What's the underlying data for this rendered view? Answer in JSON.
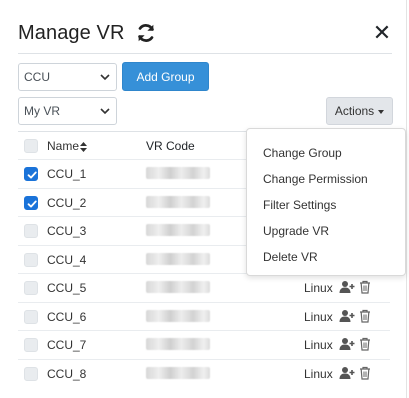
{
  "header": {
    "title": "Manage VR"
  },
  "controls": {
    "group_select": "CCU",
    "vr_select": "My VR",
    "add_group_label": "Add Group",
    "actions_label": "Actions"
  },
  "table": {
    "columns": {
      "name": "Name",
      "vr_code": "VR Code"
    },
    "rows": [
      {
        "name": "CCU_1",
        "checked": true,
        "os": ""
      },
      {
        "name": "CCU_2",
        "checked": true,
        "os": ""
      },
      {
        "name": "CCU_3",
        "checked": false,
        "os": ""
      },
      {
        "name": "CCU_4",
        "checked": false,
        "os": ""
      },
      {
        "name": "CCU_5",
        "checked": false,
        "os": "Linux"
      },
      {
        "name": "CCU_6",
        "checked": false,
        "os": "Linux"
      },
      {
        "name": "CCU_7",
        "checked": false,
        "os": "Linux"
      },
      {
        "name": "CCU_8",
        "checked": false,
        "os": "Linux"
      }
    ]
  },
  "actions_menu": {
    "items": [
      "Change Group",
      "Change Permission",
      "Filter Settings",
      "Upgrade VR",
      "Delete VR"
    ]
  },
  "colors": {
    "primary": "#3690d8",
    "checkbox_checked": "#1a73d9"
  },
  "icons": [
    "refresh-icon",
    "close-icon",
    "chevron-down-icon",
    "sort-icon",
    "check-icon",
    "add-user-icon",
    "trash-icon"
  ]
}
